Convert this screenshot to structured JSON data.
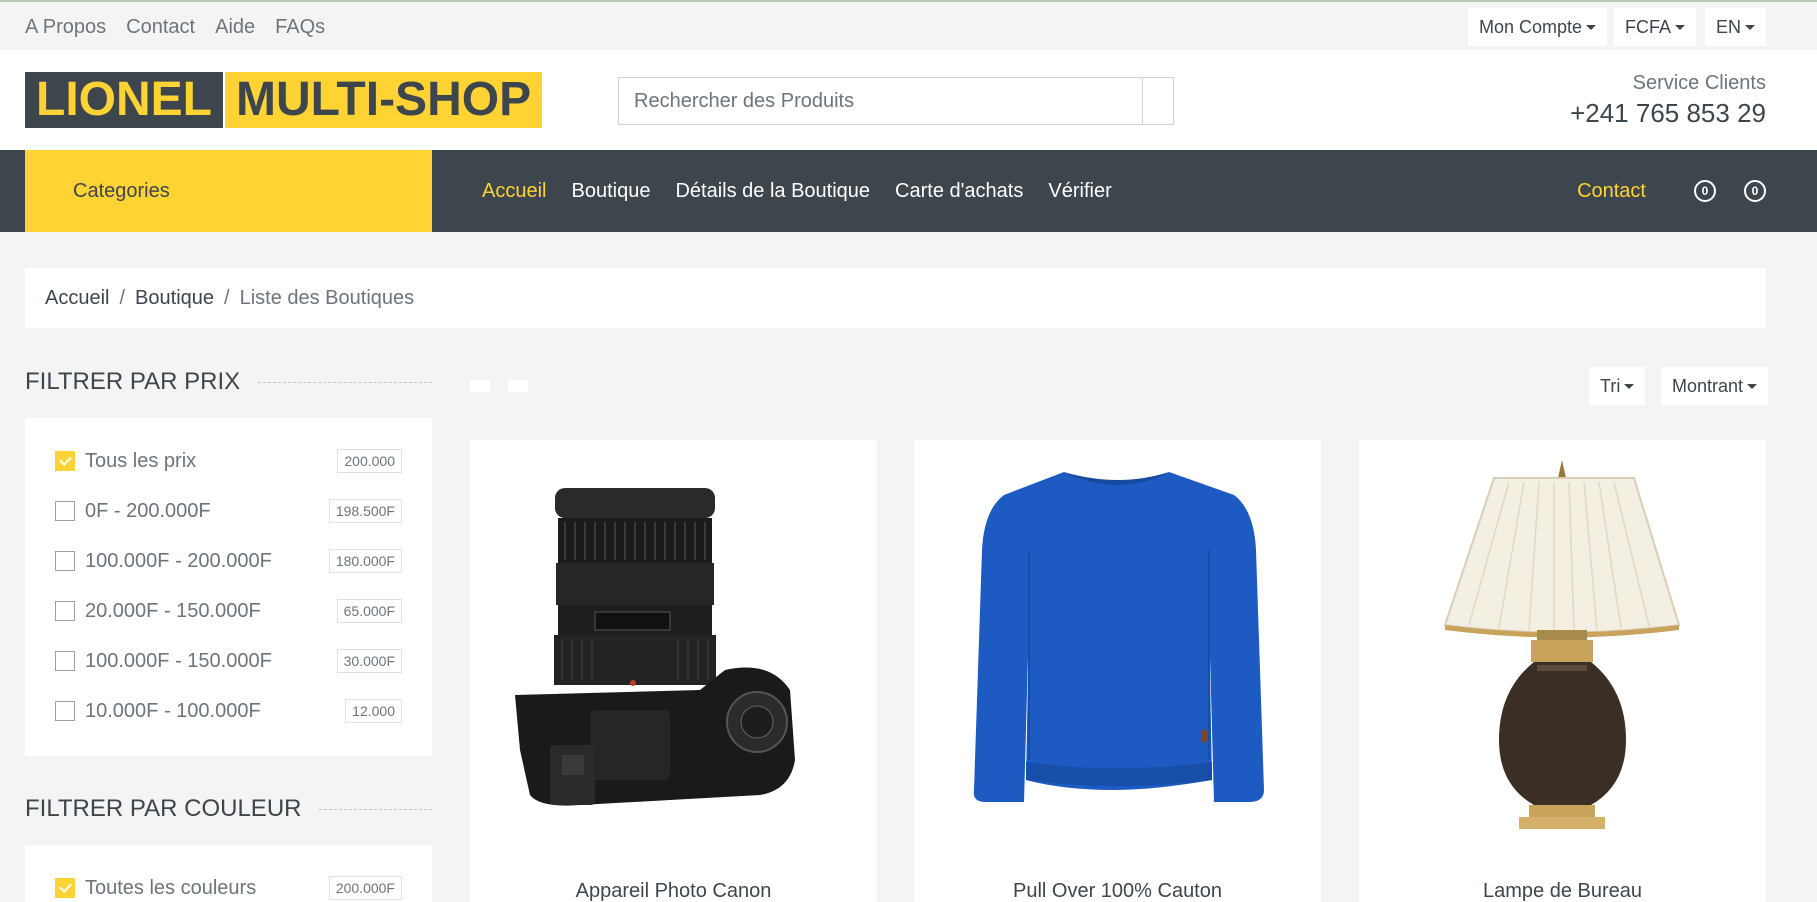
{
  "topbar": {
    "links": [
      "A Propos",
      "Contact",
      "Aide",
      "FAQs"
    ],
    "account": "Mon Compte",
    "currency": "FCFA",
    "language": "EN"
  },
  "header": {
    "logo_part1": "LIONEL",
    "logo_part2": "MULTI-SHOP",
    "search_placeholder": "Rechercher des Produits",
    "service_label": "Service Clients",
    "service_phone": "+241 765 853 29"
  },
  "nav": {
    "categories": "Categories",
    "links": [
      {
        "label": "Accueil",
        "active": true
      },
      {
        "label": "Boutique",
        "active": false
      },
      {
        "label": "Détails de la Boutique",
        "active": false
      },
      {
        "label": "Carte d'achats",
        "active": false
      },
      {
        "label": "Vérifier",
        "active": false
      }
    ],
    "contact": "Contact",
    "wishlist_count": "0",
    "cart_count": "0"
  },
  "breadcrumb": {
    "items": [
      "Accueil",
      "Boutique"
    ],
    "current": "Liste des Boutiques",
    "separator": "/"
  },
  "filters": {
    "price_title": "FILTRER PAR PRIX",
    "price": [
      {
        "label": "Tous les prix",
        "count": "200.000",
        "checked": true
      },
      {
        "label": "0F - 200.000F",
        "count": "198.500F",
        "checked": false
      },
      {
        "label": "100.000F - 200.000F",
        "count": "180.000F",
        "checked": false
      },
      {
        "label": "20.000F - 150.000F",
        "count": "65.000F",
        "checked": false
      },
      {
        "label": "100.000F - 150.000F",
        "count": "30.000F",
        "checked": false
      },
      {
        "label": "10.000F - 100.000F",
        "count": "12.000",
        "checked": false
      }
    ],
    "color_title": "FILTRER PAR COULEUR",
    "color": [
      {
        "label": "Toutes les couleurs",
        "count": "200.000F",
        "checked": true
      }
    ]
  },
  "toolbar": {
    "sort": "Tri",
    "showing": "Montrant"
  },
  "products": [
    {
      "name": "Appareil Photo Canon",
      "image": "camera"
    },
    {
      "name": "Pull Over 100% Cauton",
      "image": "sweater"
    },
    {
      "name": "Lampe de Bureau",
      "image": "lamp"
    }
  ],
  "colors": {
    "accent": "#ffd333",
    "dark": "#3d464d"
  }
}
